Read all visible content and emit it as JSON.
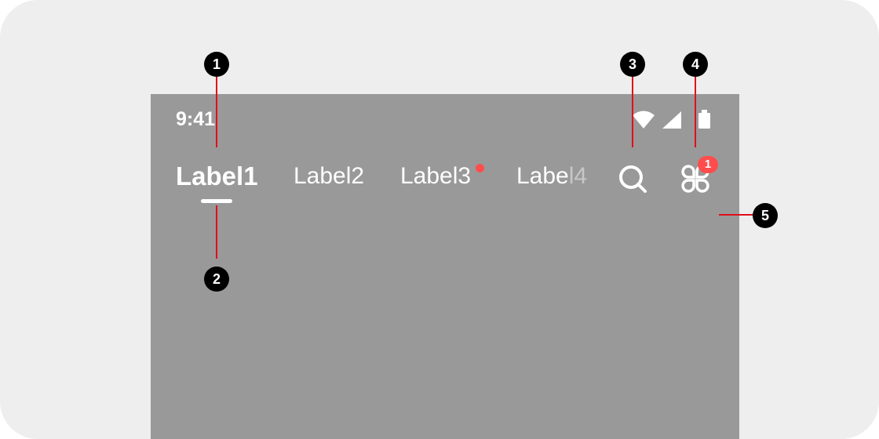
{
  "status_bar": {
    "time": "9:41",
    "icons": [
      "wifi-icon",
      "cellular-signal-icon",
      "battery-icon"
    ]
  },
  "tabs": [
    {
      "label": "Label1",
      "active": true
    },
    {
      "label": "Label2",
      "active": false
    },
    {
      "label": "Label3",
      "active": false,
      "has_dot": true
    },
    {
      "label_solid": "Labe",
      "label_faded": "l4",
      "active": false
    }
  ],
  "actions": {
    "search_icon": "search-icon",
    "apps_icon": "apps-icon",
    "apps_badge": "1"
  },
  "callouts": [
    "1",
    "2",
    "3",
    "4",
    "5"
  ],
  "colors": {
    "canvas": "#eeeeee",
    "screen": "#999999",
    "accent_red": "#ff4d4d",
    "leader_line": "#e0101a",
    "callout_marker": "#000000"
  }
}
